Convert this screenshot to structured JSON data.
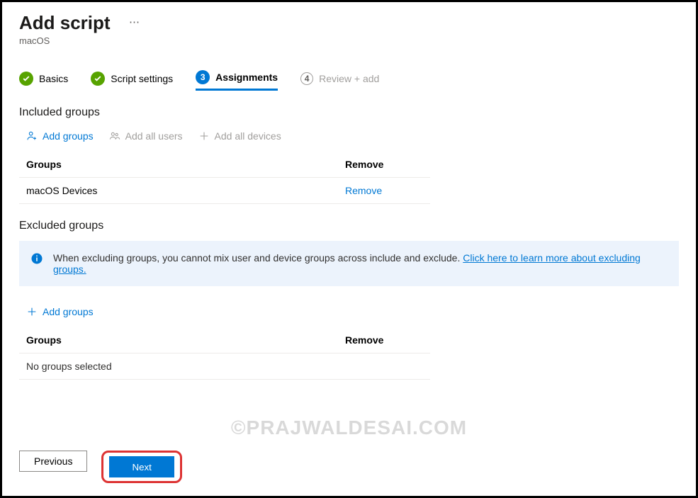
{
  "header": {
    "title": "Add script",
    "subtitle": "macOS"
  },
  "wizard": {
    "steps": [
      {
        "label": "Basics",
        "state": "done"
      },
      {
        "label": "Script settings",
        "state": "done"
      },
      {
        "label": "Assignments",
        "state": "current",
        "number": "3"
      },
      {
        "label": "Review + add",
        "state": "pending",
        "number": "4"
      }
    ]
  },
  "included": {
    "heading": "Included groups",
    "toolbar": {
      "add_groups": "Add groups",
      "add_all_users": "Add all users",
      "add_all_dev": "Add all devices"
    },
    "table": {
      "col_groups": "Groups",
      "col_remove": "Remove",
      "rows": [
        {
          "group": "macOS Devices",
          "remove_label": "Remove"
        }
      ]
    }
  },
  "excluded": {
    "heading": "Excluded groups",
    "info_text": "When excluding groups, you cannot mix user and device groups across include and exclude. ",
    "info_link": "Click here to learn more about excluding groups.",
    "toolbar": {
      "add_groups": "Add groups"
    },
    "table": {
      "col_groups": "Groups",
      "col_remove": "Remove",
      "empty": "No groups selected"
    }
  },
  "footer": {
    "previous": "Previous",
    "next": "Next"
  },
  "watermark": "©PRAJWALDESAI.COM"
}
